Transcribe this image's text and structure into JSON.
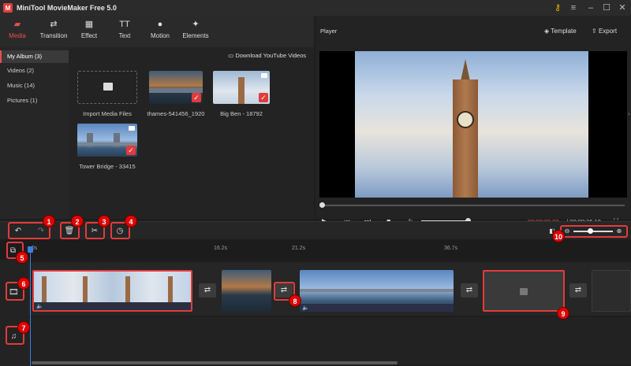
{
  "app": {
    "title": "MiniTool MovieMaker Free 5.0",
    "logo": "M"
  },
  "toolbar": {
    "items": [
      {
        "label": "Media",
        "icon": "folder-icon",
        "glyph": "▰"
      },
      {
        "label": "Transition",
        "icon": "transition-icon",
        "glyph": "⇄"
      },
      {
        "label": "Effect",
        "icon": "effect-icon",
        "glyph": "▦"
      },
      {
        "label": "Text",
        "icon": "text-icon",
        "glyph": "TT"
      },
      {
        "label": "Motion",
        "icon": "motion-icon",
        "glyph": "●"
      },
      {
        "label": "Elements",
        "icon": "elements-icon",
        "glyph": "✦"
      }
    ]
  },
  "library": {
    "items": [
      "My Album (3)",
      "Videos (2)",
      "Music (14)",
      "Pictures (1)"
    ],
    "download_label": "Download YouTube Videos",
    "import_label": "Import Media Files",
    "media": [
      "thames-541456_1920",
      "Big Ben - 18792",
      "Tower Bridge - 33415"
    ]
  },
  "player": {
    "title": "Player",
    "template_label": "Template",
    "export_label": "Export",
    "time_current": "00:00:00.00",
    "time_total": "/ 00:00:36.18",
    "progress": 0,
    "volume": 1.0
  },
  "timeline": {
    "ticks": [
      "0s",
      "16.2s",
      "21.2s",
      "36.7s"
    ],
    "zoom": 0.45
  },
  "badges": [
    "1",
    "2",
    "3",
    "4",
    "5",
    "6",
    "7",
    "8",
    "9",
    "10"
  ],
  "colors": {
    "accent": "#e8504c",
    "badge": "#e00000",
    "playhead": "#3a7fe0"
  }
}
